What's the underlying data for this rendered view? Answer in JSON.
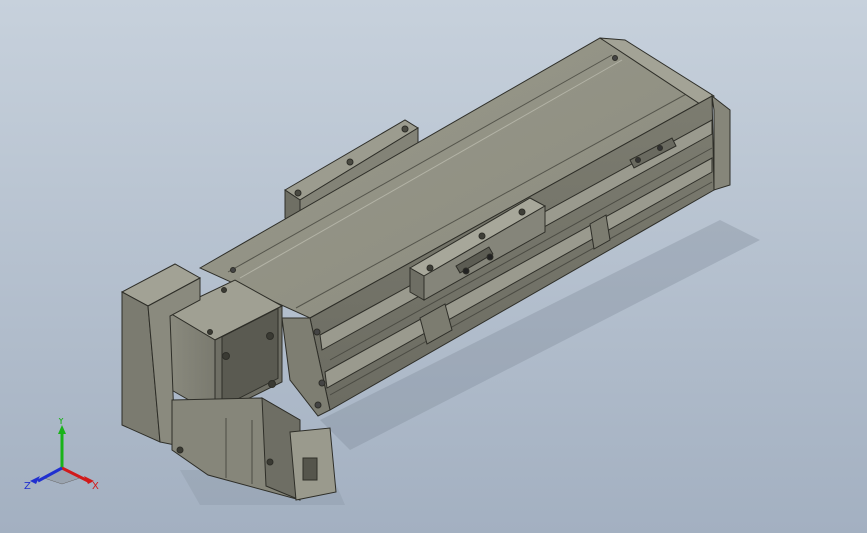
{
  "viewport": {
    "background_top": "#c7d1dc",
    "background_bottom": "#a3b0c1"
  },
  "model": {
    "body_color": "#8f8f82",
    "dark_color": "#5f5f55",
    "light_color": "#a3a396"
  },
  "triad": {
    "x_label": "X",
    "y_label": "Y",
    "z_label": "Z",
    "x_color": "#d11a1a",
    "y_color": "#19b319",
    "z_color": "#2030d0"
  }
}
